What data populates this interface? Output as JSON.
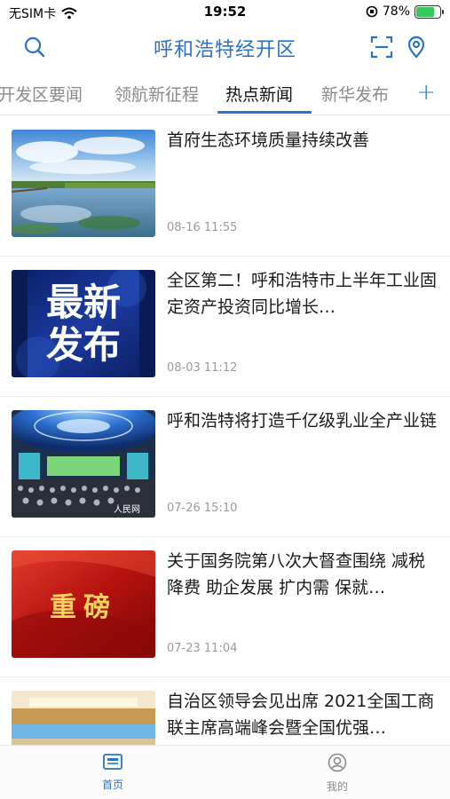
{
  "status_bar": {
    "carrier": "无SIM卡",
    "time": "19:52",
    "battery": "78%",
    "battery_level": 0.78
  },
  "header": {
    "title": "呼和浩特经开区",
    "left_icon": "search-icon",
    "right_icons": [
      "scan-icon",
      "location-icon"
    ]
  },
  "tabs": {
    "items": [
      "开发区要闻",
      "领航新征程",
      "热点新闻",
      "新华发布"
    ],
    "active_index": 2,
    "add_label": "+"
  },
  "news": [
    {
      "title": "首府生态环境质量持续改善",
      "time": "08-16 11:55"
    },
    {
      "title": "全区第二！呼和浩特市上半年工业固定资产投资同比增长…",
      "time": "08-03 11:12",
      "thumb_text": [
        "最新",
        "发布"
      ]
    },
    {
      "title": "呼和浩特将打造千亿级乳业全产业链",
      "time": "07-26 15:10",
      "thumb_watermark": "人民网"
    },
    {
      "title": "关于国务院第八次大督查围绕 减税降费 助企发展 扩内需 保就…",
      "time": "07-23 11:04",
      "thumb_text": [
        "重磅"
      ]
    },
    {
      "title": "自治区领导会见出席 2021全国工商联主席高端峰会暨全国优强…",
      "time": ""
    }
  ],
  "bottom_nav": {
    "items": [
      {
        "label": "首页",
        "icon": "home-news-icon",
        "active": true
      },
      {
        "label": "我的",
        "icon": "profile-icon",
        "active": false
      }
    ]
  },
  "colors": {
    "accent": "#2a72c9",
    "battery_green": "#34c759"
  }
}
